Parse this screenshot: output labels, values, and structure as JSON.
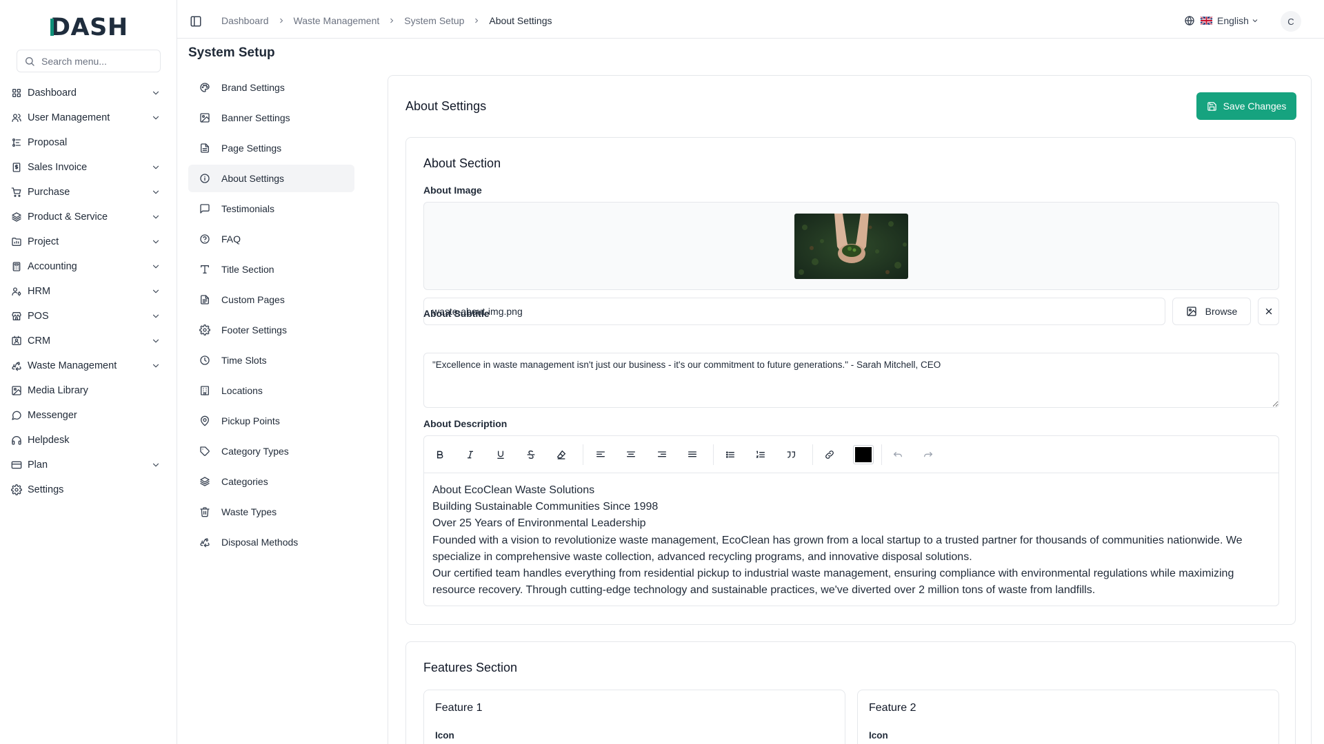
{
  "app": {
    "logo_text": "DASH"
  },
  "search": {
    "placeholder": "Search menu..."
  },
  "sidebar": {
    "items": [
      {
        "label": "Dashboard",
        "icon": "grid-icon",
        "expandable": true
      },
      {
        "label": "User Management",
        "icon": "users-icon",
        "expandable": true
      },
      {
        "label": "Proposal",
        "icon": "proposal-icon",
        "expandable": false
      },
      {
        "label": "Sales Invoice",
        "icon": "invoice-icon",
        "expandable": true
      },
      {
        "label": "Purchase",
        "icon": "cart-icon",
        "expandable": true
      },
      {
        "label": "Product & Service",
        "icon": "layers-icon",
        "expandable": true
      },
      {
        "label": "Project",
        "icon": "folder-icon",
        "expandable": true
      },
      {
        "label": "Accounting",
        "icon": "calculator-icon",
        "expandable": true
      },
      {
        "label": "HRM",
        "icon": "hrm-icon",
        "expandable": true
      },
      {
        "label": "POS",
        "icon": "store-icon",
        "expandable": true
      },
      {
        "label": "CRM",
        "icon": "crm-icon",
        "expandable": true
      },
      {
        "label": "Waste Management",
        "icon": "recycle-icon",
        "expandable": true
      },
      {
        "label": "Media Library",
        "icon": "image-icon",
        "expandable": false
      },
      {
        "label": "Messenger",
        "icon": "message-icon",
        "expandable": false
      },
      {
        "label": "Helpdesk",
        "icon": "headphones-icon",
        "expandable": false
      },
      {
        "label": "Plan",
        "icon": "plan-icon",
        "expandable": true
      },
      {
        "label": "Settings",
        "icon": "gear-icon",
        "expandable": false
      }
    ]
  },
  "header": {
    "breadcrumb": [
      "Dashboard",
      "Waste Management",
      "System Setup",
      "About Settings"
    ],
    "language": "English",
    "avatar_initial": "C"
  },
  "page": {
    "title": "System Setup"
  },
  "submenu": {
    "active_index": 3,
    "items": [
      {
        "label": "Brand Settings",
        "icon": "palette-icon"
      },
      {
        "label": "Banner Settings",
        "icon": "image-icon"
      },
      {
        "label": "Page Settings",
        "icon": "file-icon"
      },
      {
        "label": "About Settings",
        "icon": "info-icon"
      },
      {
        "label": "Testimonials",
        "icon": "message-square-icon"
      },
      {
        "label": "FAQ",
        "icon": "help-circle-icon"
      },
      {
        "label": "Title Section",
        "icon": "type-icon"
      },
      {
        "label": "Custom Pages",
        "icon": "file-text-icon"
      },
      {
        "label": "Footer Settings",
        "icon": "gear-icon"
      },
      {
        "label": "Time Slots",
        "icon": "clock-icon"
      },
      {
        "label": "Locations",
        "icon": "building-icon"
      },
      {
        "label": "Pickup Points",
        "icon": "map-pin-icon"
      },
      {
        "label": "Category Types",
        "icon": "tag-icon"
      },
      {
        "label": "Categories",
        "icon": "layers-icon"
      },
      {
        "label": "Waste Types",
        "icon": "trash-icon"
      },
      {
        "label": "Disposal Methods",
        "icon": "recycle-icon"
      }
    ]
  },
  "main": {
    "title": "About Settings",
    "save_label": "Save Changes",
    "about_section": {
      "title": "About Section",
      "image_label": "About Image",
      "image_file": "waste-about-img.png",
      "browse_label": "Browse",
      "subtitle_label": "About Subtitle",
      "subtitle_value": "\"Excellence in waste management isn't just our business - it's our commitment to future generations.\" - Sarah Mitchell, CEO",
      "description_label": "About Description",
      "description_lines": [
        "About EcoClean Waste Solutions",
        "Building Sustainable Communities Since 1998",
        "Over 25 Years of Environmental Leadership",
        "Founded with a vision to revolutionize waste management, EcoClean has grown from a local startup to a trusted partner for thousands of communities nationwide. We specialize in comprehensive waste collection, advanced recycling programs, and innovative disposal solutions.",
        "Our certified team handles everything from residential pickup to industrial waste management, ensuring compliance with environmental regulations while maximizing resource recovery. Through cutting-edge technology and sustainable practices, we've diverted over 2 million tons of waste from landfills."
      ],
      "text_color": "#000000"
    },
    "features_section": {
      "title": "Features Section",
      "features": [
        {
          "title": "Feature 1",
          "icon_label": "Icon"
        },
        {
          "title": "Feature 2",
          "icon_label": "Icon"
        }
      ]
    }
  },
  "colors": {
    "accent": "#16a37f",
    "logo_teal": "#0e8f78",
    "logo_dark": "#1f2d3d"
  }
}
